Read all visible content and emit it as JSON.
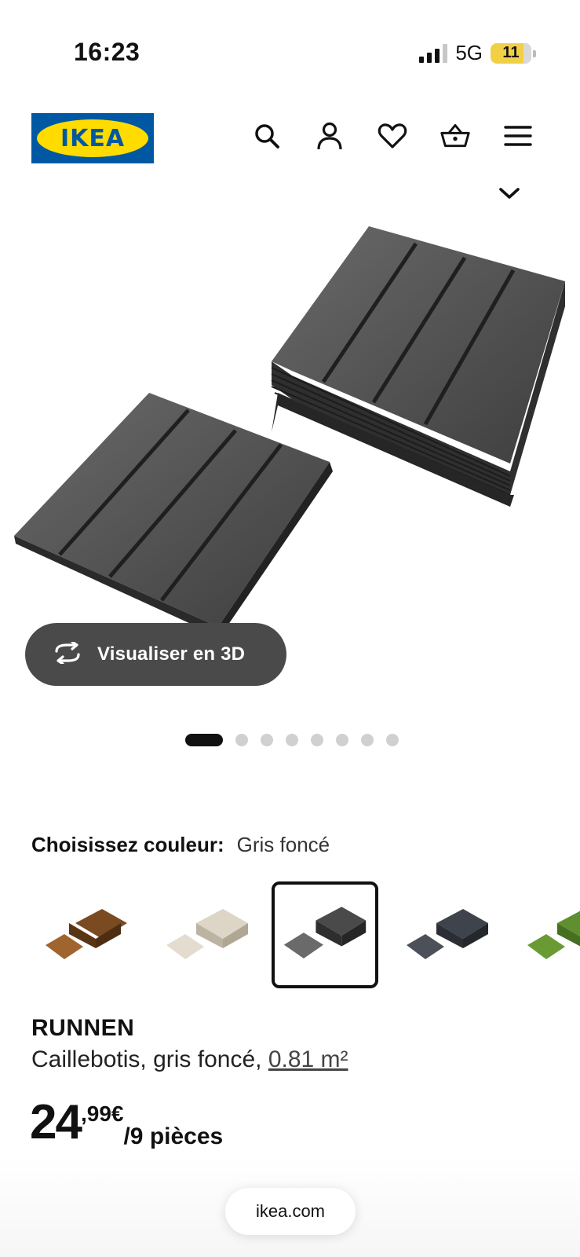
{
  "status_bar": {
    "time": "16:23",
    "network": "5G",
    "battery": "11"
  },
  "header": {
    "logo_text": "IKEA",
    "icons": [
      "search-icon",
      "account-icon",
      "heart-icon",
      "cart-icon",
      "menu-icon"
    ]
  },
  "gallery": {
    "view_3d_label": "Visualiser en 3D",
    "slide_count": 8,
    "active_slide": 1
  },
  "color_picker": {
    "label": "Choisissez couleur:",
    "selected_value": "Gris foncé",
    "swatches": [
      {
        "name": "brun",
        "color": "#8a5a2b"
      },
      {
        "name": "beige",
        "color": "#d9d1c2"
      },
      {
        "name": "gris foncé",
        "color": "#4a4a4a",
        "selected": true
      },
      {
        "name": "anthracite",
        "color": "#3c4046"
      },
      {
        "name": "vert",
        "color": "#5f8f2f"
      }
    ]
  },
  "product": {
    "name": "RUNNEN",
    "description": "Caillebotis, gris foncé, ",
    "area": "0.81 m²",
    "price_int": "24",
    "price_dec": ",99€",
    "price_unit": "/9 pièces"
  },
  "browser": {
    "url": "ikea.com"
  },
  "colors": {
    "ikea_blue": "#0058a3",
    "ikea_yellow": "#ffdb00",
    "button_dark": "#4a4a4a"
  }
}
